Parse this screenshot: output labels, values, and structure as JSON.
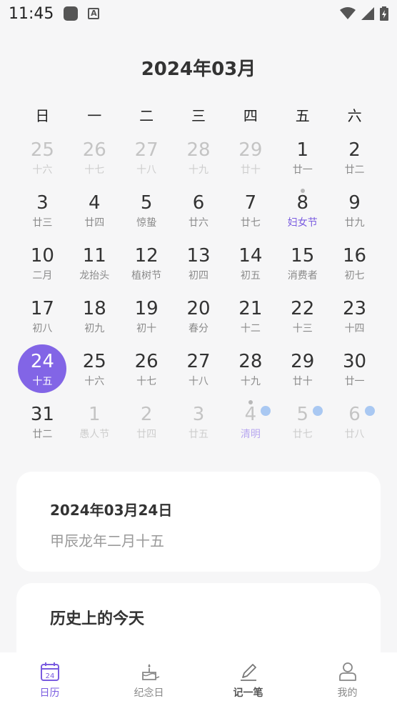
{
  "status_bar": {
    "time": "11:45"
  },
  "calendar": {
    "month_title": "2024年03月",
    "weekdays": [
      "日",
      "一",
      "二",
      "三",
      "四",
      "五",
      "六"
    ],
    "days": [
      {
        "n": "25",
        "l": "十六",
        "out": true
      },
      {
        "n": "26",
        "l": "十七",
        "out": true
      },
      {
        "n": "27",
        "l": "十八",
        "out": true
      },
      {
        "n": "28",
        "l": "十九",
        "out": true
      },
      {
        "n": "29",
        "l": "廿十",
        "out": true
      },
      {
        "n": "1",
        "l": "廿一"
      },
      {
        "n": "2",
        "l": "廿二"
      },
      {
        "n": "3",
        "l": "廿三"
      },
      {
        "n": "4",
        "l": "廿四"
      },
      {
        "n": "5",
        "l": "惊蛰"
      },
      {
        "n": "6",
        "l": "廿六"
      },
      {
        "n": "7",
        "l": "廿七"
      },
      {
        "n": "8",
        "l": "妇女节",
        "holiday": true,
        "dot": true
      },
      {
        "n": "9",
        "l": "廿九"
      },
      {
        "n": "10",
        "l": "二月"
      },
      {
        "n": "11",
        "l": "龙抬头"
      },
      {
        "n": "12",
        "l": "植树节"
      },
      {
        "n": "13",
        "l": "初四"
      },
      {
        "n": "14",
        "l": "初五"
      },
      {
        "n": "15",
        "l": "消费者"
      },
      {
        "n": "16",
        "l": "初七"
      },
      {
        "n": "17",
        "l": "初八"
      },
      {
        "n": "18",
        "l": "初九"
      },
      {
        "n": "19",
        "l": "初十"
      },
      {
        "n": "20",
        "l": "春分"
      },
      {
        "n": "21",
        "l": "十二"
      },
      {
        "n": "22",
        "l": "十三"
      },
      {
        "n": "23",
        "l": "十四"
      },
      {
        "n": "24",
        "l": "十五",
        "selected": true
      },
      {
        "n": "25",
        "l": "十六"
      },
      {
        "n": "26",
        "l": "十七"
      },
      {
        "n": "27",
        "l": "十八"
      },
      {
        "n": "28",
        "l": "十九"
      },
      {
        "n": "29",
        "l": "廿十"
      },
      {
        "n": "30",
        "l": "廿一"
      },
      {
        "n": "31",
        "l": "廿二"
      },
      {
        "n": "1",
        "l": "愚人节",
        "out": true
      },
      {
        "n": "2",
        "l": "廿四",
        "out": true
      },
      {
        "n": "3",
        "l": "廿五",
        "out": true
      },
      {
        "n": "4",
        "l": "清明",
        "out": true,
        "holiday": true,
        "dot": true,
        "blue": true
      },
      {
        "n": "5",
        "l": "廿七",
        "out": true,
        "blue": true
      },
      {
        "n": "6",
        "l": "廿八",
        "out": true,
        "blue": true
      }
    ]
  },
  "date_card": {
    "date": "2024年03月24日",
    "lunar": "甲辰龙年二月十五"
  },
  "history_card": {
    "title": "历史上的今天"
  },
  "tabbar": {
    "tabs": [
      {
        "label": "日历",
        "icon": "calendar-icon",
        "badge": "24"
      },
      {
        "label": "纪念日",
        "icon": "cake-icon"
      },
      {
        "label": "记一笔",
        "icon": "pencil-icon"
      },
      {
        "label": "我的",
        "icon": "user-icon"
      }
    ]
  },
  "colors": {
    "accent": "#8265e6",
    "holiday_text": "#7a5ce0",
    "event_dot": "#a9c8f2"
  }
}
